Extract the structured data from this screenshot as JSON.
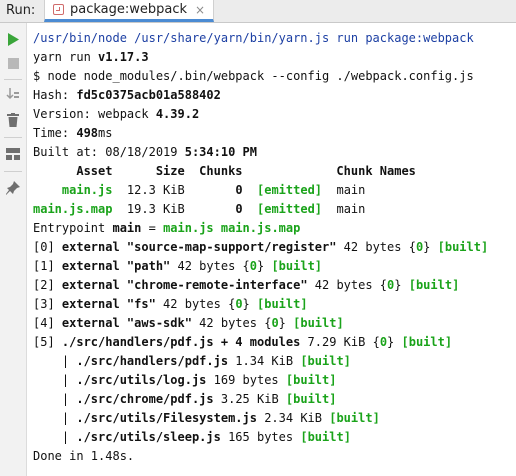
{
  "tabbar": {
    "run_label": "Run:",
    "tab_label": "package:webpack",
    "close_glyph": "×"
  },
  "toolbar": [
    {
      "name": "rerun-icon",
      "color": "#3aa53a"
    },
    {
      "name": "stop-icon",
      "color": "#b8b8b8"
    },
    {
      "name": "sort-icon",
      "color": "#9a9a9a"
    },
    {
      "name": "trash-icon",
      "color": "#6f6f6f"
    },
    {
      "name": "layout-icon",
      "color": "#6f6f6f"
    },
    {
      "name": "pin-icon",
      "color": "#6f6f6f"
    }
  ],
  "console": {
    "l01": "/usr/bin/node /usr/share/yarn/bin/yarn.js run package:webpack",
    "l02_text": "yarn run ",
    "l02_ver": "v1.17.3",
    "l03": "$ node node_modules/.bin/webpack --config ./webpack.config.js",
    "l04_label": "Hash: ",
    "l04_val": "fd5c0375acb01a588402",
    "l05_label": "Version: webpack ",
    "l05_val": "4.39.2",
    "l06_label": "Time: ",
    "l06_val": "498",
    "l06_unit": "ms",
    "l07_label": "Built at: 08/18/2019 ",
    "l07_val": "5:34:10 PM",
    "l08": "      Asset      Size  Chunks             Chunk Names",
    "l09_pre": "    ",
    "l09_asset": "main.js",
    "l09_mid": "  12.3 KiB       ",
    "l09_chunk": "0",
    "l09_sp": "  ",
    "l09_emit": "[emitted]",
    "l09_name": "  main",
    "l10_asset": "main.js.map",
    "l10_mid": "  19.3 KiB       ",
    "l10_chunk": "0",
    "l10_sp": "  ",
    "l10_emit": "[emitted]",
    "l10_name": "  main",
    "l11_label": "Entrypoint ",
    "l11_name": "main",
    "l11_eq": " = ",
    "l11_f1": "main.js",
    "l11_f2": " main.js.map",
    "l12_pre": "[0] ",
    "l12_b": "external \"source-map-support/register\"",
    "l12_mid": " 42 bytes {",
    "l12_chunk": "0",
    "l12_close": "} ",
    "l12_built": "[built]",
    "l13_pre": "[1] ",
    "l13_b": "external \"path\"",
    "l13_mid": " 42 bytes {",
    "l13_chunk": "0",
    "l13_close": "} ",
    "l13_built": "[built]",
    "l14_pre": "[2] ",
    "l14_b": "external \"chrome-remote-interface\"",
    "l14_mid": " 42 bytes {",
    "l14_chunk": "0",
    "l14_close": "} ",
    "l14_built": "[built]",
    "l15_pre": "[3] ",
    "l15_b": "external \"fs\"",
    "l15_mid": " 42 bytes {",
    "l15_chunk": "0",
    "l15_close": "} ",
    "l15_built": "[built]",
    "l16_pre": "[4] ",
    "l16_b": "external \"aws-sdk\"",
    "l16_mid": " 42 bytes {",
    "l16_chunk": "0",
    "l16_close": "} ",
    "l16_built": "[built]",
    "l17_pre": "[5] ",
    "l17_b": "./src/handlers/pdf.js + 4 modules",
    "l17_mid": " 7.29 KiB {",
    "l17_chunk": "0",
    "l17_close": "} ",
    "l17_built": "[built]",
    "l18_pre": "    | ",
    "l18_b": "./src/handlers/pdf.js",
    "l18_mid": " 1.34 KiB ",
    "l18_built": "[built]",
    "l19_pre": "    | ",
    "l19_b": "./src/utils/log.js",
    "l19_mid": " 169 bytes ",
    "l19_built": "[built]",
    "l20_pre": "    | ",
    "l20_b": "./src/chrome/pdf.js",
    "l20_mid": " 3.25 KiB ",
    "l20_built": "[built]",
    "l21_pre": "    | ",
    "l21_b": "./src/utils/Filesystem.js",
    "l21_mid": " 2.34 KiB ",
    "l21_built": "[built]",
    "l22_pre": "    | ",
    "l22_b": "./src/utils/sleep.js",
    "l22_mid": " 165 bytes ",
    "l22_built": "[built]",
    "l23": "Done in 1.48s."
  }
}
